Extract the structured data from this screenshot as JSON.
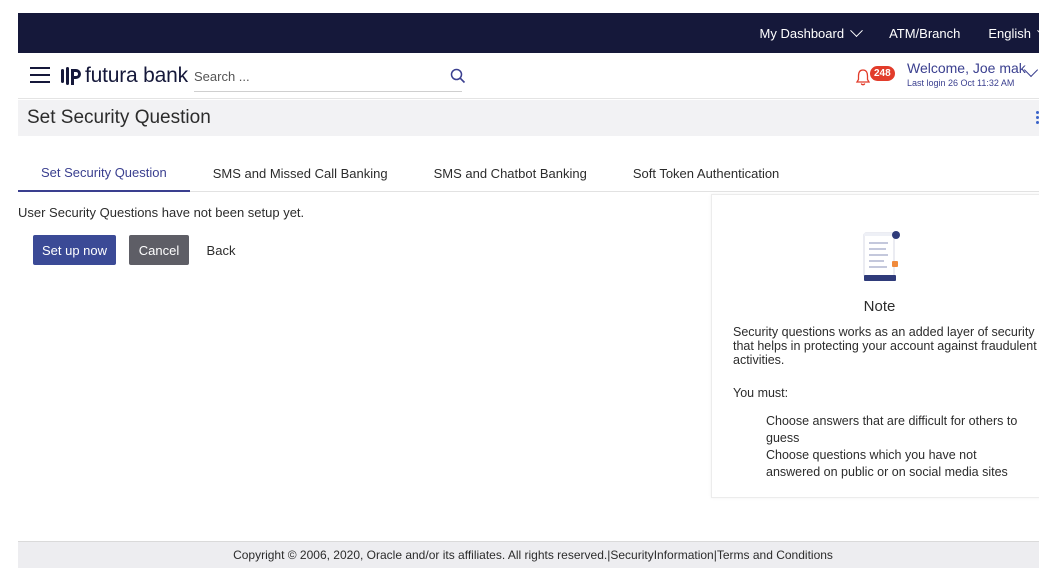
{
  "topbar": {
    "dashboard_label": "My Dashboard",
    "atm_label": "ATM/Branch",
    "language_label": "English"
  },
  "header": {
    "brand": "futura bank",
    "search_placeholder": "Search ...",
    "notification_count": "248",
    "welcome": "Welcome, Joe mak",
    "last_login": "Last login 26 Oct 11:32 AM"
  },
  "page": {
    "title": "Set Security Question"
  },
  "tabs": [
    {
      "label": "Set Security Question",
      "active": true
    },
    {
      "label": "SMS and Missed Call Banking",
      "active": false
    },
    {
      "label": "SMS and Chatbot Banking",
      "active": false
    },
    {
      "label": "Soft Token Authentication",
      "active": false
    }
  ],
  "main": {
    "message": "User Security Questions have not been setup yet.",
    "setup_label": "Set up now",
    "cancel_label": "Cancel",
    "back_label": "Back"
  },
  "note": {
    "title": "Note",
    "description": "Security questions works as an added layer of security that helps in protecting your account against fraudulent activities.",
    "must_label": "You must:",
    "items": [
      "Choose answers that are difficult for others to guess",
      "Choose questions which you have not answered on public or on social media sites"
    ]
  },
  "footer": {
    "copyright": "Copyright © 2006, 2020, Oracle and/or its affiliates. All rights reserved.",
    "separator": "|",
    "security_link": "SecurityInformation",
    "terms_link": "Terms and Conditions"
  },
  "colors": {
    "topbar_bg": "#15183a",
    "primary": "#3b4a96",
    "accent_text": "#3a3f8f",
    "badge": "#e23c2b"
  }
}
